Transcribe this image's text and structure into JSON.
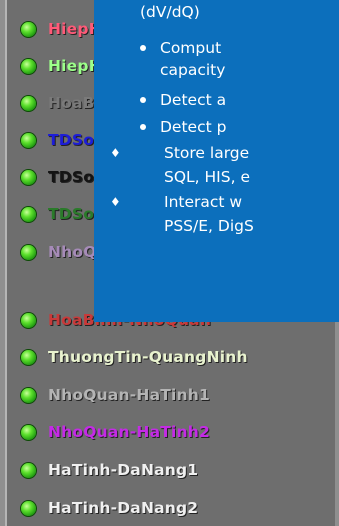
{
  "elements": [
    {
      "label": "HiepHo",
      "color": "#ff5a78"
    },
    {
      "label": "HiepHo",
      "color": "#9cff8a"
    },
    {
      "label": "HoaBin",
      "color": "#7a7a7a"
    },
    {
      "label": "TDSon",
      "color": "#1d1dd8"
    },
    {
      "label": "TDSon",
      "color": "#141414"
    },
    {
      "label": "TDSon",
      "color": "#2a7a2a"
    },
    {
      "label": "NhoQu",
      "color": "#a68bb8"
    },
    {
      "label": "HoaBinh-NhoQuan",
      "color": "#c83a3a"
    },
    {
      "label": "ThuongTin-QuangNinh",
      "color": "#e9f3cf"
    },
    {
      "label": "NhoQuan-HaTinh1",
      "color": "#b4b4b4"
    },
    {
      "label": "NhoQuan-HaTinh2",
      "color": "#c42ae6"
    },
    {
      "label": "HaTinh-DaNang1",
      "color": "#f0f0f0"
    },
    {
      "label": "HaTinh-DaNang2",
      "color": "#f0f0f0"
    }
  ],
  "popup": {
    "line1": "(dV/dQ)",
    "bullet1a": "Comput",
    "bullet1b": "capacity",
    "bullet2": "Detect a",
    "bullet3": "Detect p",
    "item1a": "Store large",
    "item1b": "SQL, HIS, e",
    "item2a": "Interact w",
    "item2b": "PSS/E, DigS",
    "bg_color": "#0c6fbc"
  }
}
